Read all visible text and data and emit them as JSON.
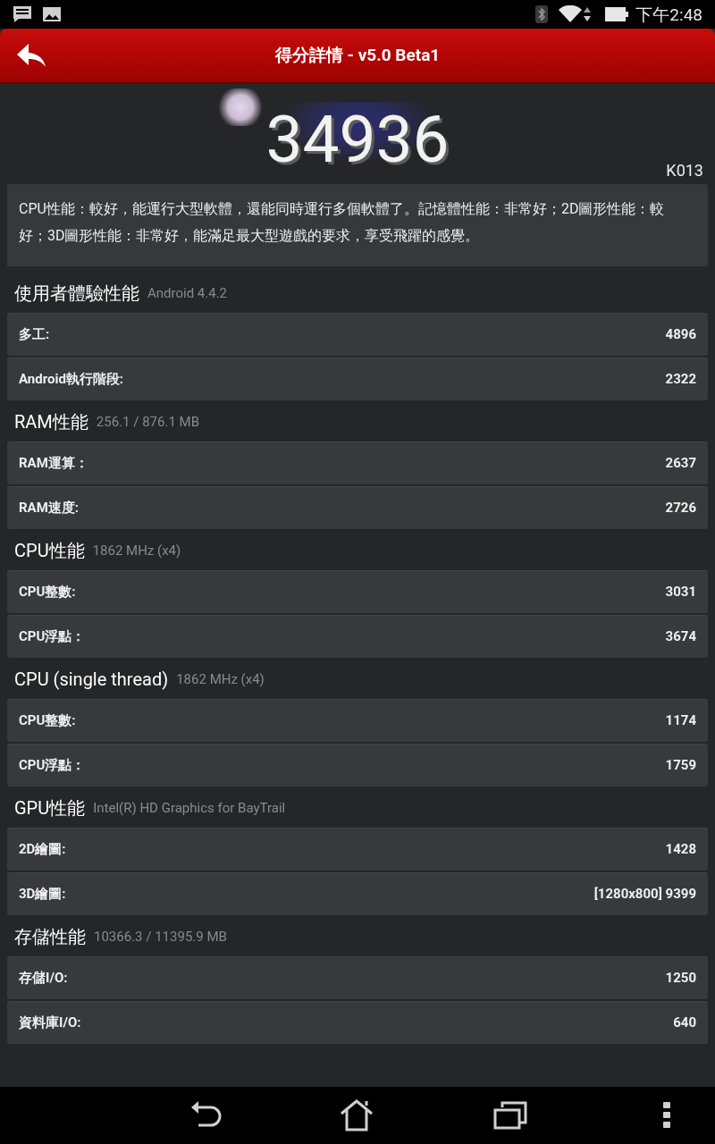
{
  "status_bar": {
    "time": "下午2:48"
  },
  "header": {
    "title": "得分詳情 - v5.0 Beta1"
  },
  "score": {
    "value": "34936",
    "device": "K013"
  },
  "summary": "CPU性能：較好，能運行大型軟體，還能同時運行多個軟體了。記憶體性能：非常好；2D圖形性能：較好；3D圖形性能：非常好，能滿足最大型遊戲的要求，享受飛躍的感覺。",
  "sections": [
    {
      "title": "使用者體驗性能",
      "subtitle": "Android 4.4.2",
      "rows": [
        {
          "label": "多工:",
          "value": "4896"
        },
        {
          "label": "Android執行階段:",
          "value": "2322"
        }
      ]
    },
    {
      "title": "RAM性能",
      "subtitle": "256.1 / 876.1 MB",
      "rows": [
        {
          "label": "RAM運算：",
          "value": "2637"
        },
        {
          "label": "RAM速度:",
          "value": "2726"
        }
      ]
    },
    {
      "title": "CPU性能",
      "subtitle": "1862 MHz (x4)",
      "rows": [
        {
          "label": "CPU整數:",
          "value": "3031"
        },
        {
          "label": "CPU浮點：",
          "value": "3674"
        }
      ]
    },
    {
      "title": "CPU (single thread)",
      "subtitle": "1862 MHz (x4)",
      "rows": [
        {
          "label": "CPU整數:",
          "value": "1174"
        },
        {
          "label": "CPU浮點：",
          "value": "1759"
        }
      ]
    },
    {
      "title": "GPU性能",
      "subtitle": "Intel(R) HD Graphics for BayTrail",
      "rows": [
        {
          "label": "2D繪圖:",
          "value": "1428"
        },
        {
          "label": "3D繪圖:",
          "value": "[1280x800] 9399"
        }
      ]
    },
    {
      "title": "存儲性能",
      "subtitle": "10366.3 / 11395.9 MB",
      "rows": [
        {
          "label": "存儲I/O:",
          "value": "1250"
        },
        {
          "label": "資料庫I/O:",
          "value": "640"
        }
      ]
    }
  ]
}
